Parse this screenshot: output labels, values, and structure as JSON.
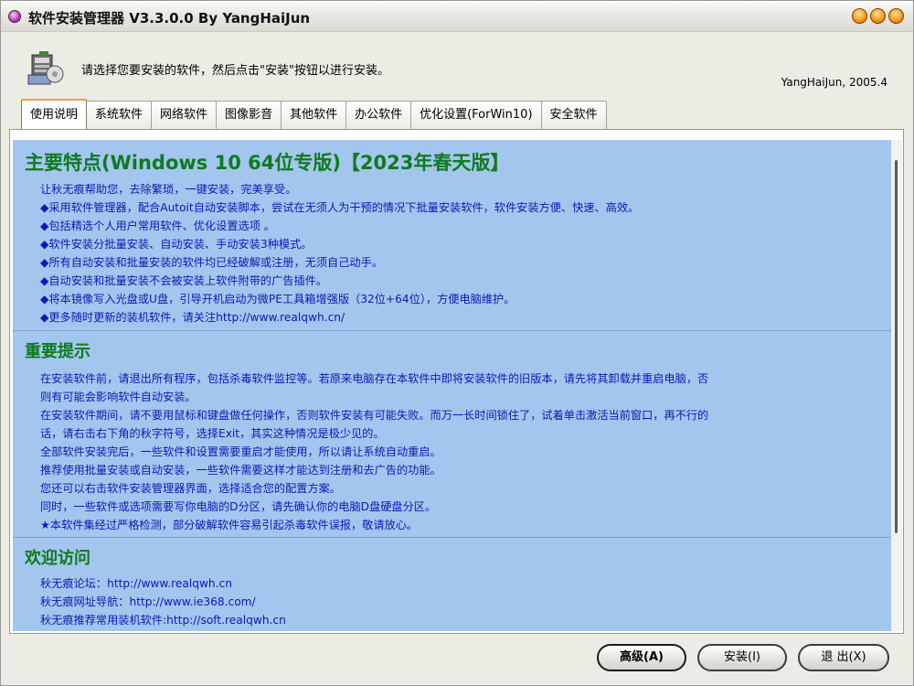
{
  "window": {
    "title": "软件安装管理器 V3.3.0.0 By YangHaiJun"
  },
  "header": {
    "message": "请选择您要安装的软件，然后点击\"安装\"按钮以进行安装。",
    "author": "YangHaiJun, 2005.4"
  },
  "tabs": [
    {
      "label": "使用说明",
      "active": true
    },
    {
      "label": "系统软件"
    },
    {
      "label": "网络软件"
    },
    {
      "label": "图像影音"
    },
    {
      "label": "其他软件"
    },
    {
      "label": "办公软件"
    },
    {
      "label": "优化设置(ForWin10)"
    },
    {
      "label": "安全软件"
    }
  ],
  "content": {
    "features_title": "主要特点(Windows 10 64位专版)【2023年春天版】",
    "features": [
      "让秋无痕帮助您，去除繁琐，一键安装，完美享受。",
      "◆采用软件管理器，配合Autoit自动安装脚本，尝试在无须人为干预的情况下批量安装软件，软件安装方便、快速、高效。",
      "◆包括精选个人用户常用软件、优化设置选项 。",
      "◆软件安装分批量安装、自动安装、手动安装3种模式。",
      "◆所有自动安装和批量安装的软件均已经破解或注册，无须自己动手。",
      "◆自动安装和批量安装不会被安装上软件附带的广告插件。",
      "◆将本镜像写入光盘或U盘，引导开机启动为微PE工具箱增强版（32位+64位），方便电脑维护。",
      "◆更多随时更新的装机软件，请关注http://www.realqwh.cn/"
    ],
    "tips_title": "重要提示",
    "tips": [
      "在安装软件前，请退出所有程序，包括杀毒软件监控等。若原来电脑存在本软件中即将安装软件的旧版本，请先将其卸载并重启电脑，否",
      "则有可能会影响软件自动安装。",
      "在安装软件期间，请不要用鼠标和键盘做任何操作，否则软件安装有可能失败。而万一长时间锁住了，试着单击激活当前窗口，再不行的",
      "话，请右击右下角的秋字符号，选择Exit，其实这种情况是极少见的。",
      "全部软件安装完后，一些软件和设置需要重启才能使用，所以请让系统自动重启。",
      "推荐使用批量安装或自动安装，一些软件需要这样才能达到注册和去广告的功能。",
      "您还可以右击软件安装管理器界面，选择适合您的配置方案。",
      "同时，一些软件或选项需要写你电脑的D分区，请先确认你的电脑D盘硬盘分区。",
      "★本软件集经过严格检测，部分破解软件容易引起杀毒软件误报，敬请放心。"
    ],
    "welcome_title": "欢迎访问",
    "links": [
      "秋无痕论坛：http://www.realqwh.cn",
      "秋无痕网址导航：http://www.ie368.com/",
      "秋无痕推荐常用装机软件:http://soft.realqwh.cn"
    ]
  },
  "buttons": {
    "advanced": "高级(A)",
    "install": "安装(I)",
    "exit": "退 出(X)"
  },
  "colors": {
    "content_bg": "#a3c6ee",
    "heading": "#0f7a1f",
    "body_text": "#0a1ab4"
  },
  "icons": {
    "app": "app-circle-icon",
    "setup": "setup-package-icon",
    "window_controls": [
      "minimize-icon",
      "maximize-icon",
      "close-icon"
    ]
  }
}
